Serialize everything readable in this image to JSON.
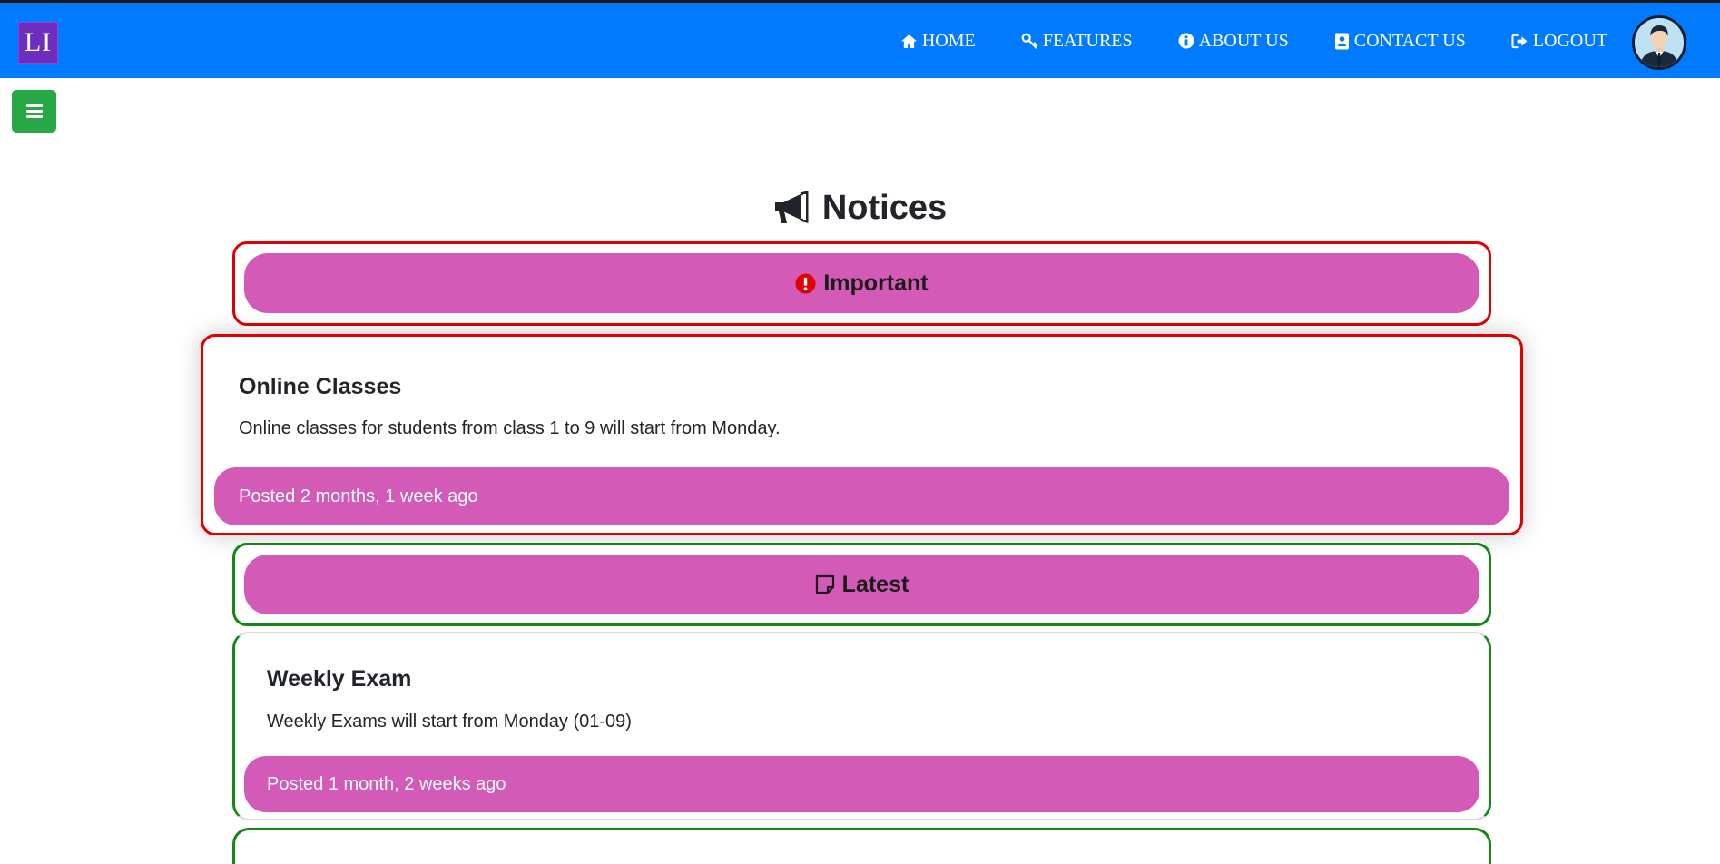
{
  "brand": {
    "logo_text": "LI"
  },
  "nav": {
    "items": [
      {
        "label": "HOME",
        "icon": "home-icon"
      },
      {
        "label": "FEATURES",
        "icon": "key-icon"
      },
      {
        "label": "ABOUT US",
        "icon": "info-icon"
      },
      {
        "label": "CONTACT US",
        "icon": "contact-book-icon"
      },
      {
        "label": "LOGOUT",
        "icon": "logout-icon"
      }
    ],
    "avatar_icon": "user-avatar-icon"
  },
  "page": {
    "title": "Notices",
    "title_icon": "megaphone-icon"
  },
  "sections": {
    "important": {
      "label": "Important",
      "icon": "exclamation-circle-icon",
      "notices": [
        {
          "title": "Online Classes",
          "body": "Online classes for students from class 1 to 9 will start from Monday.",
          "posted": "Posted 2 months, 1 week ago"
        }
      ]
    },
    "latest": {
      "label": "Latest",
      "icon": "sticky-note-icon",
      "notices": [
        {
          "title": "Weekly Exam",
          "body": "Weekly Exams will start from Monday (01-09)",
          "posted": "Posted 1 month, 2 weeks ago"
        }
      ]
    }
  },
  "colors": {
    "navbar": "#007bff",
    "brand_bg": "#6f2dbd",
    "toggle_bg": "#28a745",
    "pill": "#d35ab6",
    "important_border": "#e00000",
    "latest_border": "#118811",
    "exclamation": "#e00000"
  }
}
